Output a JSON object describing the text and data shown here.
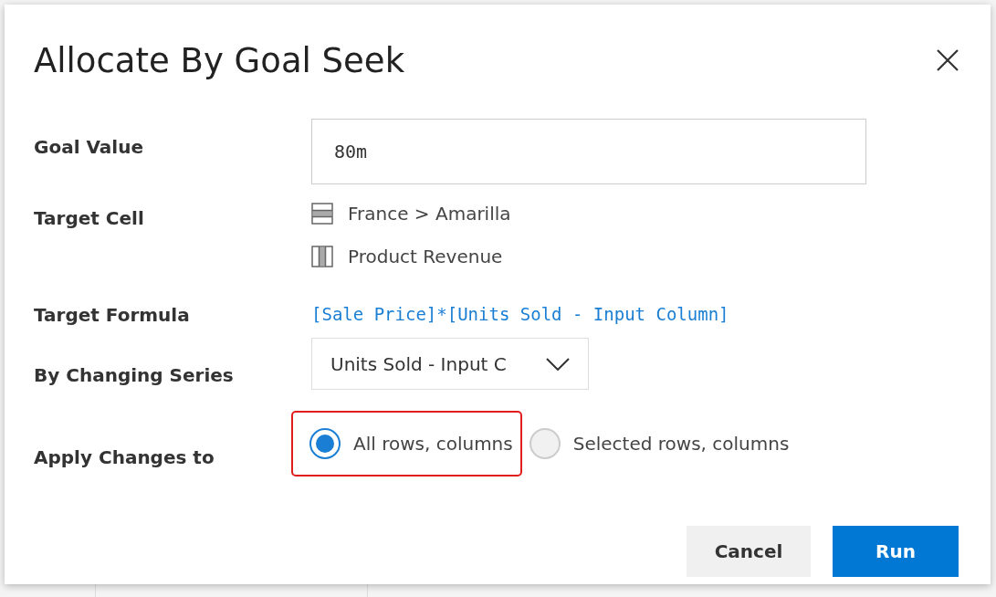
{
  "dialog": {
    "title": "Allocate By Goal Seek",
    "fields": [
      {
        "kind": "input",
        "label": "Goal Value",
        "value": "80m"
      },
      {
        "kind": "cells",
        "label": "Target Cell",
        "items": [
          {
            "kind": "row",
            "text": "France > Amarilla"
          },
          {
            "kind": "column",
            "text": "Product Revenue"
          }
        ]
      },
      {
        "kind": "formula",
        "label": "Target Formula",
        "text": "[Sale Price]*[Units Sold - Input Column]"
      },
      {
        "kind": "select",
        "label": "By Changing Series",
        "value": "Units Sold - Input C"
      },
      {
        "kind": "radio",
        "label": "Apply Changes to",
        "options": [
          {
            "label": "All rows, columns",
            "selected": true,
            "highlighted": true
          },
          {
            "label": "Selected rows, columns",
            "selected": false,
            "highlighted": false
          }
        ]
      }
    ],
    "buttons": [
      {
        "label": "Cancel",
        "kind": "secondary"
      },
      {
        "label": "Run",
        "kind": "primary"
      }
    ]
  }
}
